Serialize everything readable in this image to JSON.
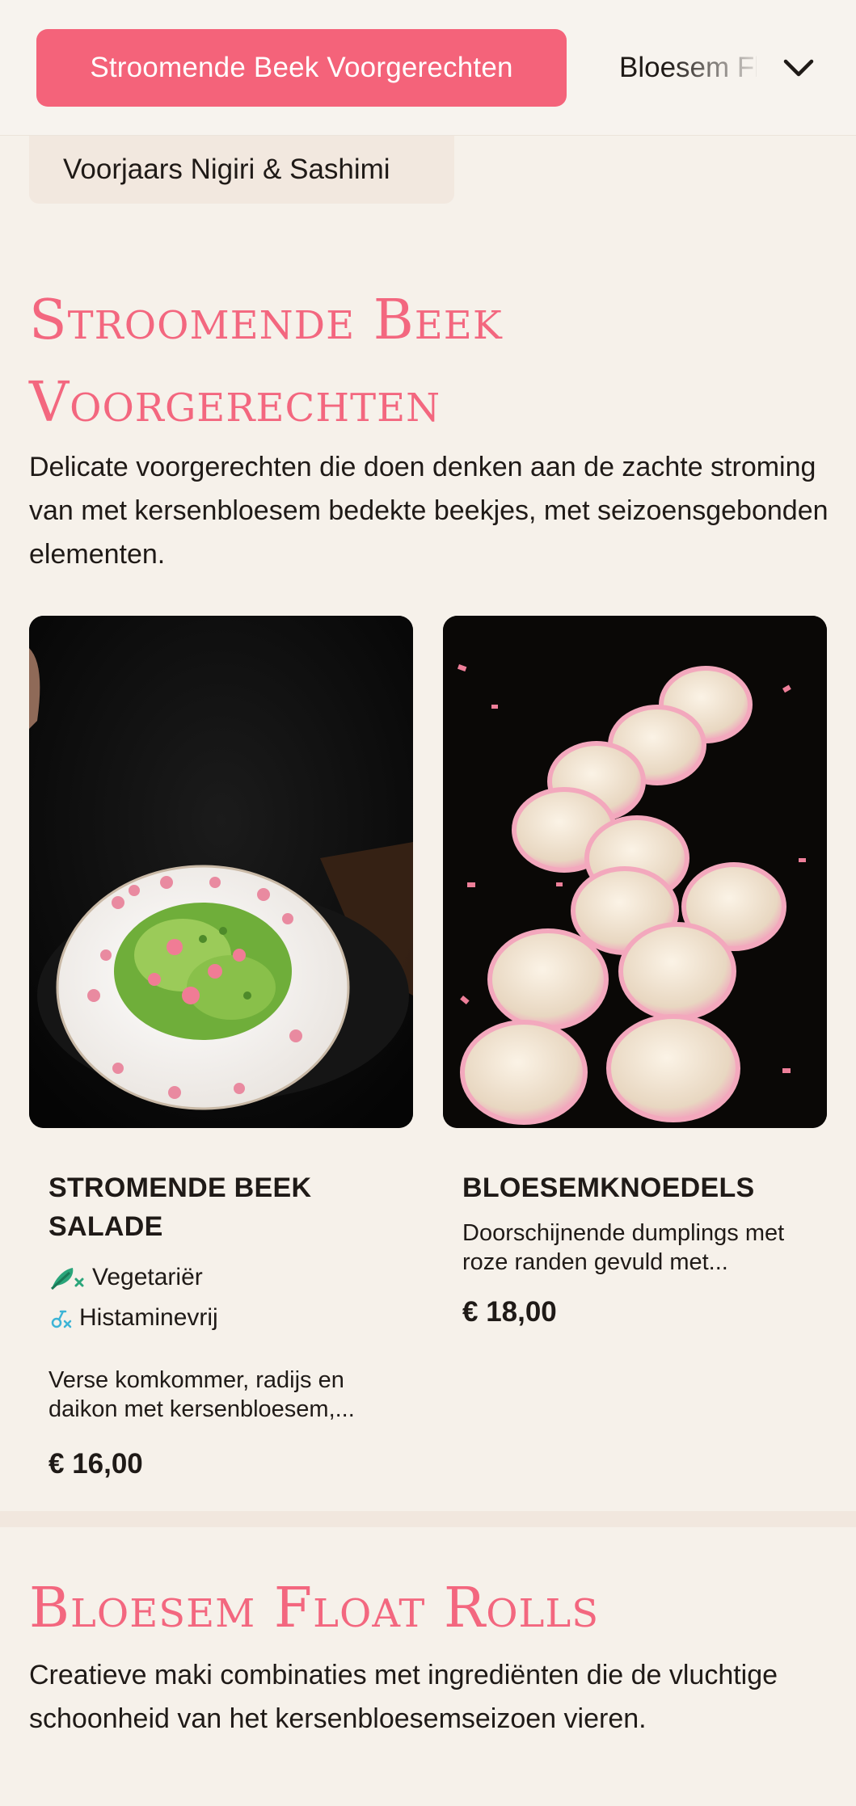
{
  "nav": {
    "active_category": "Stroomende Beek Voorgerechten",
    "next_category": "Bloesem Float Rolls",
    "subcategory_chip": "Voorjaars Nigiri & Sashimi",
    "accent_color": "#f4637a",
    "expand_icon": "chevron-down-icon"
  },
  "sections": [
    {
      "title_line1": "Stroomende Beek",
      "title_line2": "Voorgerechten",
      "description": "Delicate voorgerechten die doen denken aan de zachte stroming van met kersenbloesem bedekte beekjes, met seizoensgebonden elementen.",
      "items": [
        {
          "name": "Stromende Beek Salade",
          "tags": [
            {
              "label": "Vegetariër",
              "icon": "vegetarian-icon"
            },
            {
              "label": "Histaminevrij",
              "icon": "histamine-free-icon"
            }
          ],
          "description": "Verse komkommer, radijs en daikon met kersenbloesem,...",
          "price": "€ 16,00"
        },
        {
          "name": "Bloesemknoedels",
          "tags": [],
          "description": "Doorschijnende dumplings met roze randen gevuld met...",
          "price": "€ 18,00"
        }
      ]
    },
    {
      "title_line1": "Bloesem Float Rolls",
      "description": "Creatieve maki combinaties met ingrediënten die de vluchtige schoonheid van het kersenbloesemseizoen vieren."
    }
  ]
}
